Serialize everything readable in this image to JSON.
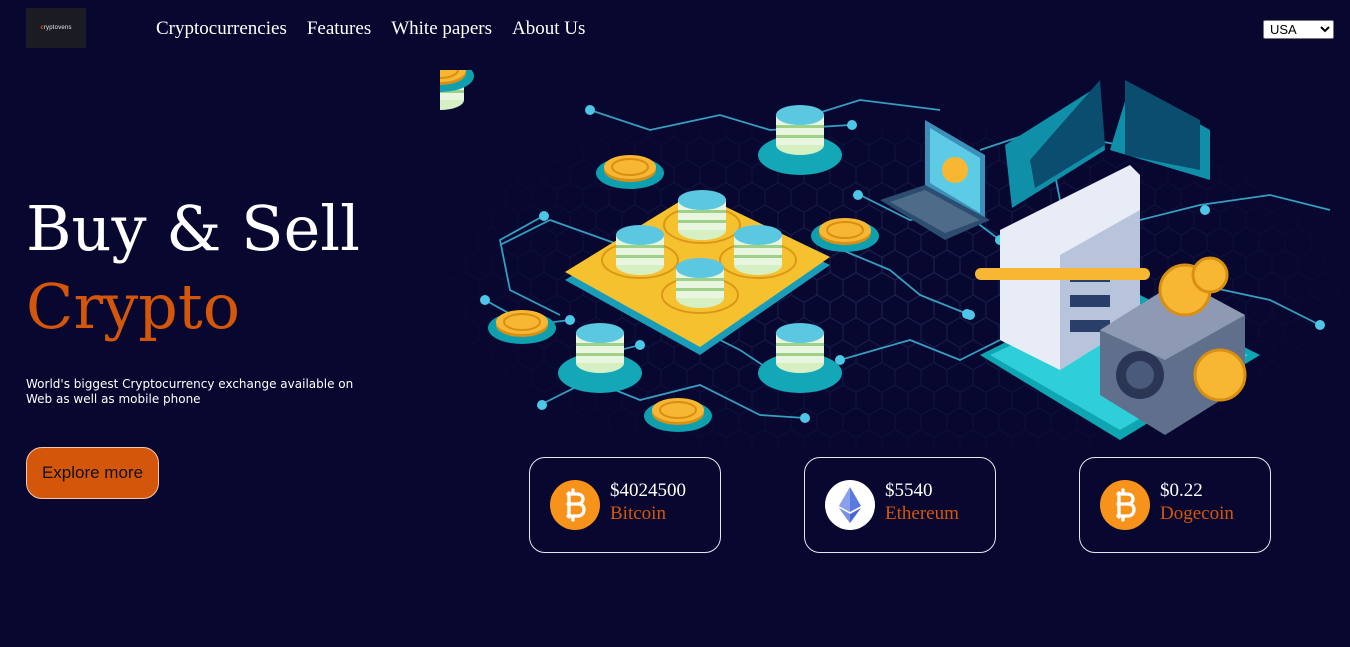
{
  "brand": {
    "logo_text_accent": "c",
    "logo_text": "ryptovens"
  },
  "nav": {
    "items": [
      {
        "label": "Cryptocurrencies"
      },
      {
        "label": "Features"
      },
      {
        "label": "White papers"
      },
      {
        "label": "About Us"
      }
    ]
  },
  "region_select": {
    "selected": "USA"
  },
  "hero": {
    "title_line1": "Buy & Sell",
    "title_line2": "Crypto",
    "description": "World's biggest Cryptocurrency exchange available on Web as well as mobile phone",
    "cta_label": "Explore more"
  },
  "coins": [
    {
      "price": "$4024500",
      "name": "Bitcoin",
      "icon": "bitcoin-icon"
    },
    {
      "price": "$5540",
      "name": "Ethereum",
      "icon": "ethereum-icon"
    },
    {
      "price": "$0.22",
      "name": "Dogecoin",
      "icon": "bitcoin-icon"
    }
  ],
  "colors": {
    "background": "#080730",
    "accent": "#d4560b",
    "teal": "#2ec4d6",
    "coin_gold": "#f7b733",
    "bitcoin_orange": "#f7931a",
    "ethereum_blue": "#4a63d8"
  }
}
